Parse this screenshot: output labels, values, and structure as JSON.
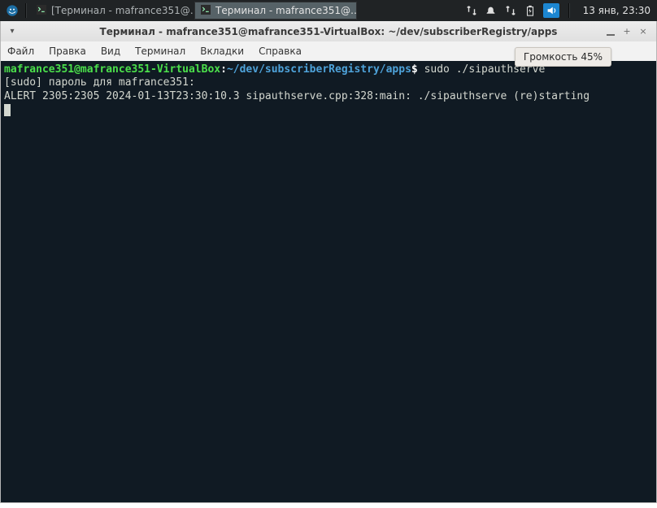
{
  "panel": {
    "tasks": [
      {
        "label": "[Терминал - mafrance351@…",
        "active": false
      },
      {
        "label": "Терминал - mafrance351@…",
        "active": true
      }
    ],
    "clock": "13 янв, 23:30",
    "volume_tooltip": "Громкость 45%"
  },
  "window": {
    "title": "Терминал - mafrance351@mafrance351-VirtualBox: ~/dev/subscriberRegistry/apps",
    "menu": [
      "Файл",
      "Правка",
      "Вид",
      "Терминал",
      "Вкладки",
      "Справка"
    ]
  },
  "terminal": {
    "prompt_user": "mafrance351@mafrance351-VirtualBox",
    "prompt_path": "~/dev/subscriberRegistry/apps",
    "prompt_suffix": "$",
    "command": "sudo ./sipauthserve",
    "lines": [
      "[sudo] пароль для mafrance351:",
      "ALERT 2305:2305 2024-01-13T23:30:10.3 sipauthserve.cpp:328:main: ./sipauthserve (re)starting"
    ]
  }
}
